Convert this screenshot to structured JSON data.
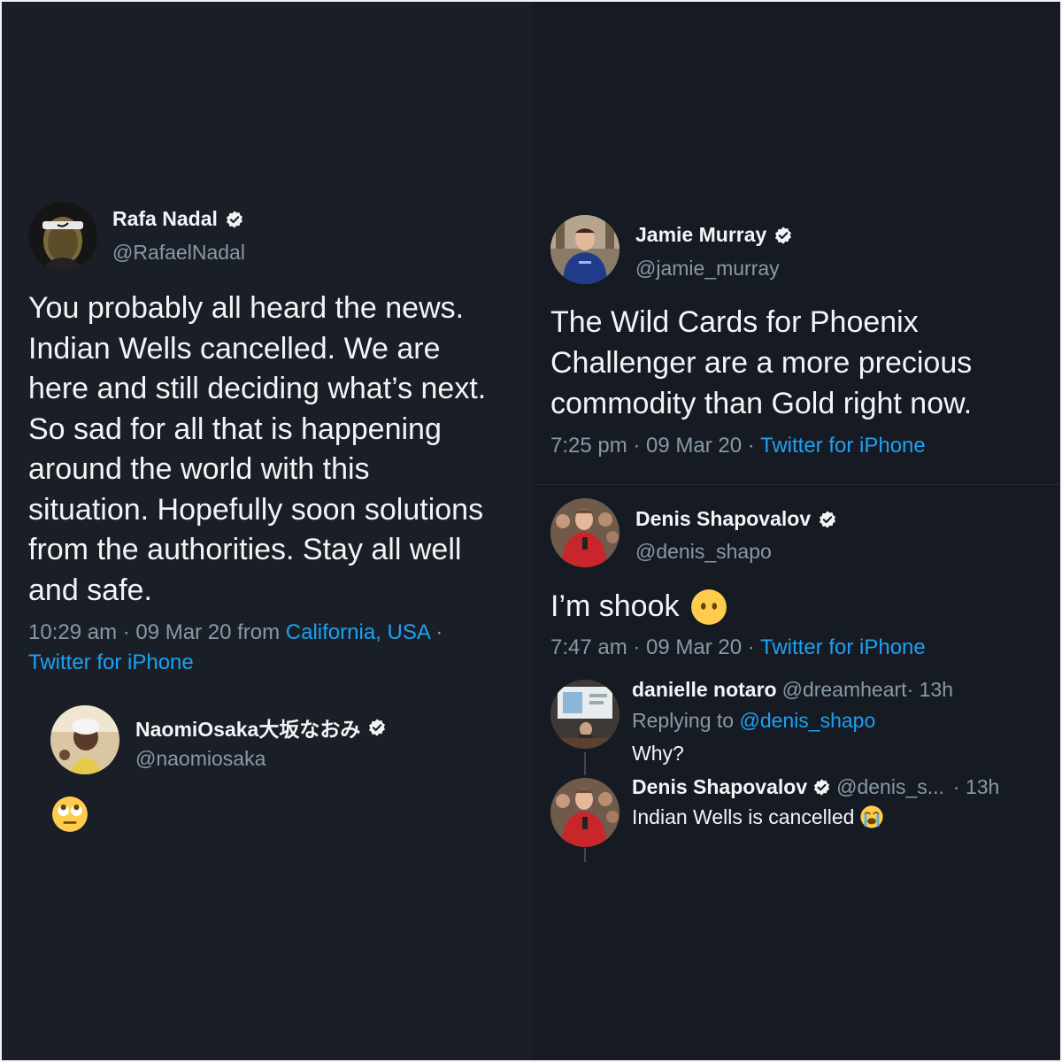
{
  "colors": {
    "background": "#1a1f27",
    "text": "#f2f4f6",
    "muted": "#8899a6",
    "link": "#1da1f2",
    "verified": "#f2f4f6",
    "emoji": "#ffcc4d"
  },
  "icons": {
    "verified": "verified-badge-icon",
    "neutral_face": "face-without-mouth-emoji",
    "eye_roll": "face-with-rolling-eyes-emoji",
    "crying": "loudly-crying-face-emoji"
  },
  "nadal": {
    "name": "Rafa Nadal",
    "handle": "@RafaelNadal",
    "lines": [
      "You probably all heard the news.",
      "Indian Wells cancelled. We are",
      "here and still deciding what’s next.",
      "So sad for all that is happening",
      "around the world with this",
      "situation. Hopefully soon solutions",
      "from the authorities. Stay all well",
      "and safe."
    ],
    "meta_time": "10:29 am · 09 Mar 20 from ",
    "meta_location": "California, USA",
    "meta_sep": " ·",
    "meta_source": "Twitter for iPhone"
  },
  "osaka": {
    "name": "NaomiOsaka大坂なおみ",
    "handle": "@naomiosaka"
  },
  "murray": {
    "name": "Jamie Murray",
    "handle": "@jamie_murray",
    "lines": [
      "The Wild Cards for Phoenix",
      "Challenger are a more precious",
      "commodity than Gold right now."
    ],
    "meta_time": "7:25 pm · 09 Mar 20 · ",
    "meta_source": "Twitter for iPhone"
  },
  "shapovalov": {
    "name": "Denis Shapovalov",
    "handle": "@denis_shapo",
    "text": "I’m shook",
    "meta_time": "7:47 am · 09 Mar 20 · ",
    "meta_source": "Twitter for iPhone"
  },
  "reply1": {
    "name": "danielle notaro",
    "handle": "@dreamheart",
    "time": " · 13h",
    "replying_prefix": "Replying to ",
    "replying_handle": "@denis_shapo",
    "text": "Why?"
  },
  "reply2": {
    "name": "Denis Shapovalov",
    "handle": "@denis_s...",
    "time": " · 13h",
    "text": "Indian Wells is cancelled"
  }
}
